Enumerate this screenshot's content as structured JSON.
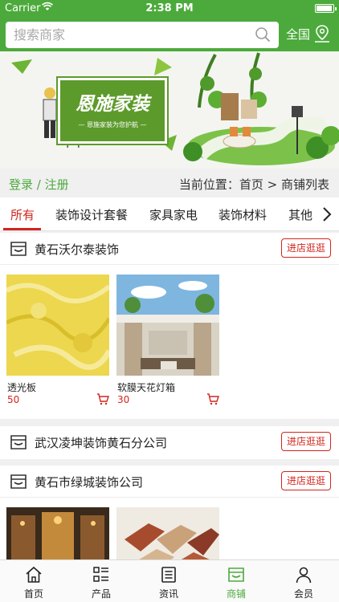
{
  "status_bar": {
    "carrier": "Carrier",
    "time": "2:38 PM"
  },
  "header": {
    "search_placeholder": "搜索商家",
    "region_label": "全国"
  },
  "banner": {
    "title": "恩施家装",
    "subtitle": "— 恩施家装为您护航 —"
  },
  "breadcrumb": {
    "login_register": "登录 / 注册",
    "current_location": "当前位置：首页 > 商铺列表"
  },
  "category_tabs": [
    {
      "label": "所有",
      "active": true
    },
    {
      "label": "装饰设计套餐",
      "active": false
    },
    {
      "label": "家具家电",
      "active": false
    },
    {
      "label": "装饰材料",
      "active": false
    },
    {
      "label": "其他",
      "active": false
    }
  ],
  "enter_shop_label": "进店逛逛",
  "shops": [
    {
      "name": "黄石沃尔泰装饰",
      "products": [
        {
          "name": "透光板",
          "price": "50"
        },
        {
          "name": "软膜天花灯箱",
          "price": "30"
        }
      ]
    },
    {
      "name": "武汉凌坤装饰黄石分公司",
      "products": []
    },
    {
      "name": "黄石市绿城装饰公司",
      "products": []
    }
  ],
  "bottom_nav": [
    {
      "label": "首页",
      "icon": "home-icon",
      "active": false
    },
    {
      "label": "产品",
      "icon": "grid-list-icon",
      "active": false
    },
    {
      "label": "资讯",
      "icon": "news-icon",
      "active": false
    },
    {
      "label": "商铺",
      "icon": "store-icon",
      "active": true
    },
    {
      "label": "会员",
      "icon": "user-icon",
      "active": false
    }
  ],
  "colors": {
    "brand_green": "#4caa3c",
    "accent_red": "#d0261d"
  }
}
